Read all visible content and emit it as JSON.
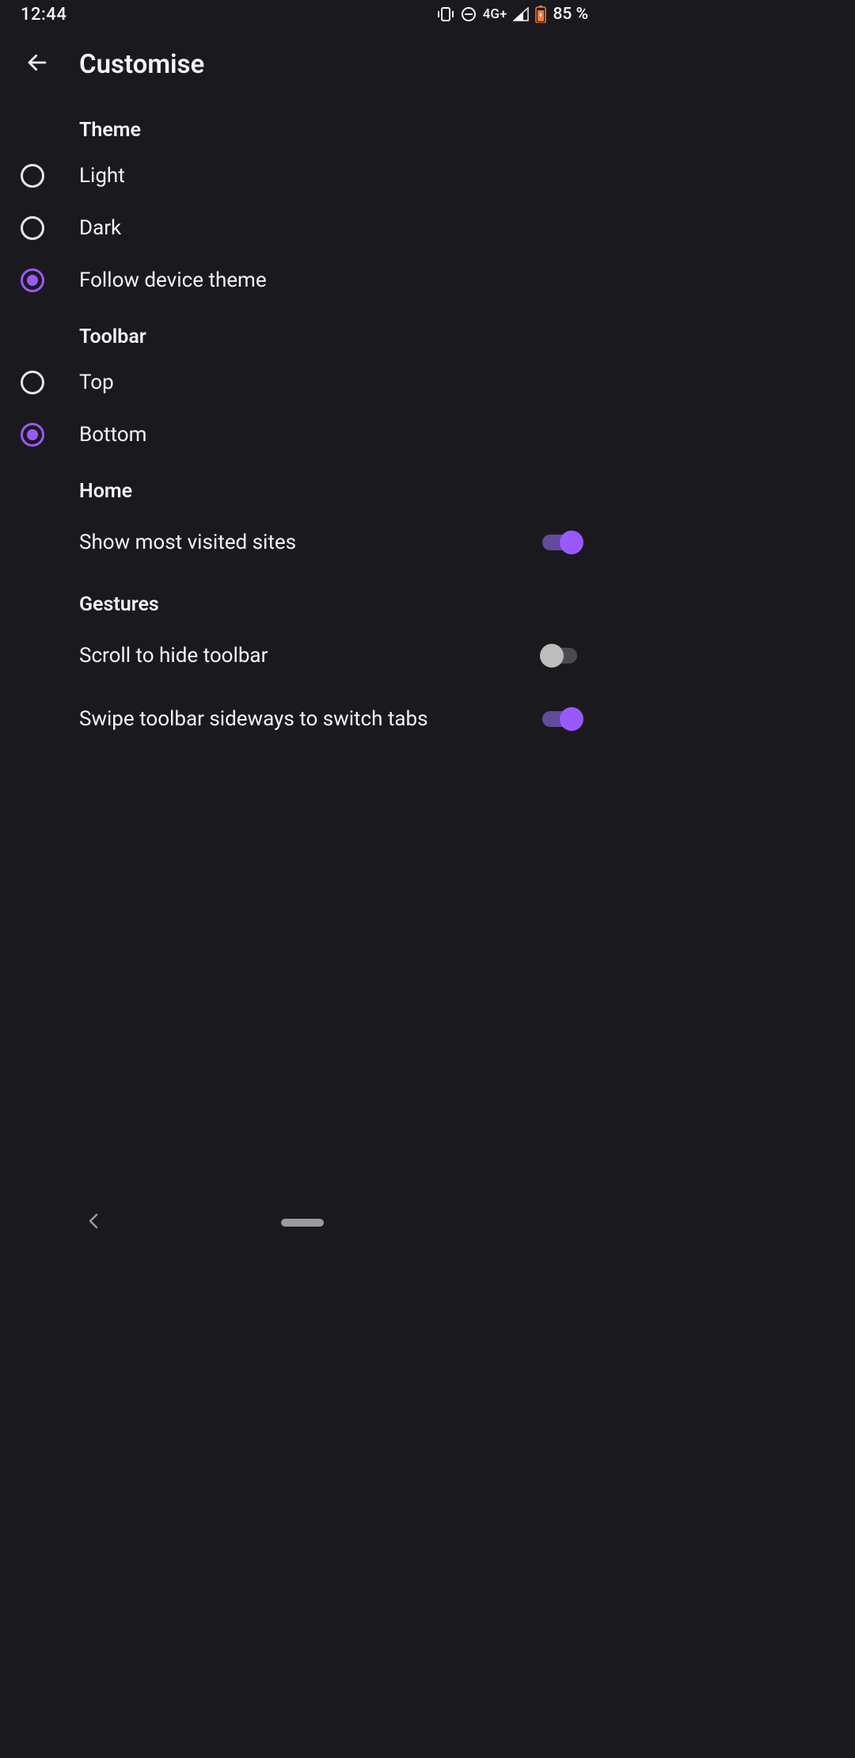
{
  "status": {
    "time": "12:44",
    "network": "4G+",
    "battery": "85 %"
  },
  "header": {
    "title": "Customise"
  },
  "sections": {
    "theme": {
      "title": "Theme",
      "options": [
        {
          "label": "Light",
          "checked": false
        },
        {
          "label": "Dark",
          "checked": false
        },
        {
          "label": "Follow device theme",
          "checked": true
        }
      ]
    },
    "toolbar": {
      "title": "Toolbar",
      "options": [
        {
          "label": "Top",
          "checked": false
        },
        {
          "label": "Bottom",
          "checked": true
        }
      ]
    },
    "home": {
      "title": "Home",
      "items": [
        {
          "label": "Show most visited sites",
          "on": true
        }
      ]
    },
    "gestures": {
      "title": "Gestures",
      "items": [
        {
          "label": "Scroll to hide toolbar",
          "on": false
        },
        {
          "label": "Swipe toolbar sideways to switch tabs",
          "on": true
        }
      ]
    }
  },
  "accent": "#9959ff"
}
